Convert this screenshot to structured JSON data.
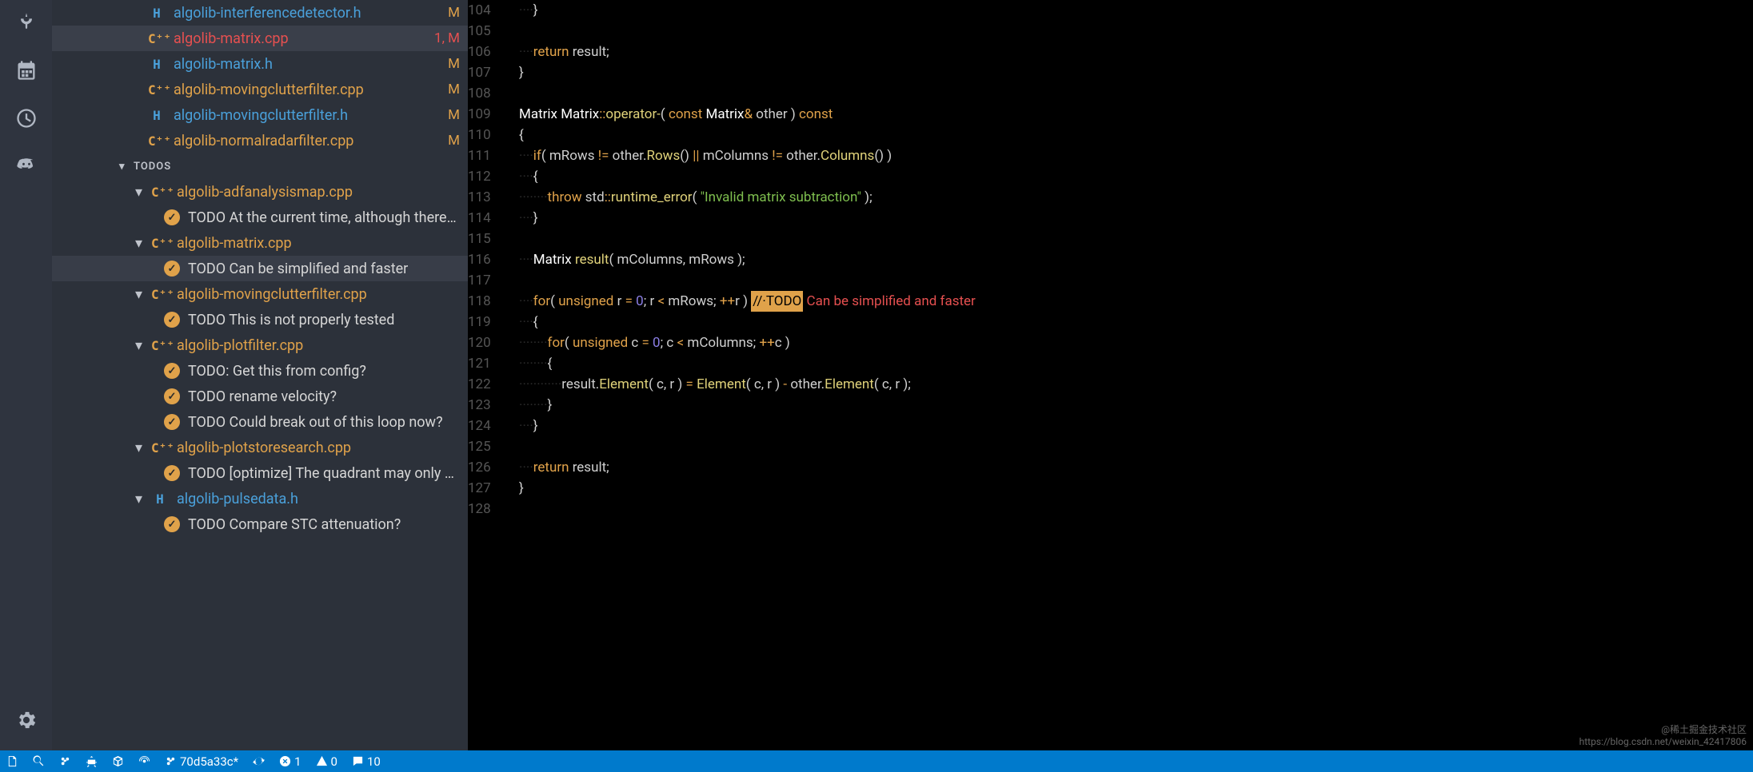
{
  "sidebar": {
    "files": [
      {
        "icon": "H",
        "name": "algolib-interferencedetector.h",
        "badge": "M",
        "sel": false
      },
      {
        "icon": "C++",
        "name": "algolib-matrix.cpp",
        "badge": "1, M",
        "sel": true
      },
      {
        "icon": "H",
        "name": "algolib-matrix.h",
        "badge": "M",
        "sel": false
      },
      {
        "icon": "C++",
        "name": "algolib-movingclutterfilter.cpp",
        "badge": "M",
        "sel": false
      },
      {
        "icon": "H",
        "name": "algolib-movingclutterfilter.h",
        "badge": "M",
        "sel": false
      },
      {
        "icon": "C++",
        "name": "algolib-normalradarfilter.cpp",
        "badge": "M",
        "sel": false
      }
    ],
    "sections": {
      "todos_label": "TODOS"
    },
    "todos": [
      {
        "icon": "C++",
        "file": "algolib-adfanalysismap.cpp",
        "items": [
          {
            "text": "TODO At the current time, although there is s…",
            "hl": false
          }
        ]
      },
      {
        "icon": "C++",
        "file": "algolib-matrix.cpp",
        "items": [
          {
            "text": "TODO Can be simplified and faster",
            "hl": true
          }
        ]
      },
      {
        "icon": "C++",
        "file": "algolib-movingclutterfilter.cpp",
        "items": [
          {
            "text": "TODO This is not properly tested",
            "hl": false
          }
        ]
      },
      {
        "icon": "C++",
        "file": "algolib-plotfilter.cpp",
        "items": [
          {
            "text": "TODO: Get this from config?",
            "hl": false
          },
          {
            "text": "TODO rename velocity?",
            "hl": false
          },
          {
            "text": "TODO Could break out of this loop now?",
            "hl": false
          }
        ]
      },
      {
        "icon": "C++",
        "file": "algolib-plotstoresearch.cpp",
        "items": [
          {
            "text": "TODO [optimize] The quadrant may only need…",
            "hl": false
          }
        ]
      },
      {
        "icon": "H",
        "file": "algolib-pulsedata.h",
        "items": [
          {
            "text": "TODO Compare STC attenuation?",
            "hl": false
          }
        ]
      }
    ]
  },
  "editor": {
    "lines": [
      {
        "n": 104,
        "seg": [
          {
            "c": "ws",
            "t": "····"
          },
          {
            "c": "",
            "t": "}"
          }
        ]
      },
      {
        "n": 105,
        "seg": []
      },
      {
        "n": 106,
        "seg": [
          {
            "c": "ws",
            "t": "····"
          },
          {
            "c": "op",
            "t": "return "
          },
          {
            "c": "",
            "t": "result;"
          }
        ]
      },
      {
        "n": 107,
        "seg": [
          {
            "c": "",
            "t": "}"
          }
        ]
      },
      {
        "n": 108,
        "seg": []
      },
      {
        "n": 109,
        "seg": [
          {
            "c": "ty",
            "t": "Matrix "
          },
          {
            "c": "ty",
            "t": "Matrix"
          },
          {
            "c": "op",
            "t": "::"
          },
          {
            "c": "fn",
            "t": "operator-"
          },
          {
            "c": "",
            "t": "( "
          },
          {
            "c": "op",
            "t": "const "
          },
          {
            "c": "ty",
            "t": "Matrix"
          },
          {
            "c": "op",
            "t": "& "
          },
          {
            "c": "",
            "t": "other ) "
          },
          {
            "c": "op",
            "t": "const"
          }
        ]
      },
      {
        "n": 110,
        "seg": [
          {
            "c": "",
            "t": "{"
          }
        ]
      },
      {
        "n": 111,
        "seg": [
          {
            "c": "ws",
            "t": "····"
          },
          {
            "c": "op",
            "t": "if"
          },
          {
            "c": "",
            "t": "( mRows "
          },
          {
            "c": "op",
            "t": "!= "
          },
          {
            "c": "",
            "t": "other."
          },
          {
            "c": "fn",
            "t": "Rows"
          },
          {
            "c": "",
            "t": "() "
          },
          {
            "c": "op",
            "t": "|| "
          },
          {
            "c": "",
            "t": "mColumns "
          },
          {
            "c": "op",
            "t": "!= "
          },
          {
            "c": "",
            "t": "other."
          },
          {
            "c": "fn",
            "t": "Columns"
          },
          {
            "c": "",
            "t": "() )"
          }
        ]
      },
      {
        "n": 112,
        "seg": [
          {
            "c": "ws",
            "t": "····"
          },
          {
            "c": "",
            "t": "{"
          }
        ]
      },
      {
        "n": 113,
        "seg": [
          {
            "c": "ws",
            "t": "········"
          },
          {
            "c": "op",
            "t": "throw "
          },
          {
            "c": "",
            "t": "std"
          },
          {
            "c": "op",
            "t": "::"
          },
          {
            "c": "fn",
            "t": "runtime_error"
          },
          {
            "c": "",
            "t": "( "
          },
          {
            "c": "st",
            "t": "\"Invalid matrix subtraction\""
          },
          {
            "c": "",
            "t": " );"
          }
        ]
      },
      {
        "n": 114,
        "seg": [
          {
            "c": "ws",
            "t": "····"
          },
          {
            "c": "",
            "t": "}"
          }
        ]
      },
      {
        "n": 115,
        "seg": []
      },
      {
        "n": 116,
        "seg": [
          {
            "c": "ws",
            "t": "····"
          },
          {
            "c": "ty",
            "t": "Matrix "
          },
          {
            "c": "fn",
            "t": "result"
          },
          {
            "c": "",
            "t": "( mColumns, mRows );"
          }
        ]
      },
      {
        "n": 117,
        "seg": []
      },
      {
        "n": 118,
        "seg": [
          {
            "c": "ws",
            "t": "····"
          },
          {
            "c": "op",
            "t": "for"
          },
          {
            "c": "",
            "t": "( "
          },
          {
            "c": "op",
            "t": "unsigned "
          },
          {
            "c": "",
            "t": "r "
          },
          {
            "c": "op",
            "t": "= "
          },
          {
            "c": "nm",
            "t": "0"
          },
          {
            "c": "",
            "t": "; r "
          },
          {
            "c": "op",
            "t": "< "
          },
          {
            "c": "",
            "t": "mRows; "
          },
          {
            "c": "op",
            "t": "++"
          },
          {
            "c": "",
            "t": "r ) "
          },
          {
            "c": "todo-hl",
            "t": "//·TODO"
          },
          {
            "c": "cm",
            "t": " Can be simplified and faster"
          }
        ]
      },
      {
        "n": 119,
        "seg": [
          {
            "c": "ws",
            "t": "····"
          },
          {
            "c": "",
            "t": "{"
          }
        ]
      },
      {
        "n": 120,
        "seg": [
          {
            "c": "ws",
            "t": "········"
          },
          {
            "c": "op",
            "t": "for"
          },
          {
            "c": "",
            "t": "( "
          },
          {
            "c": "op",
            "t": "unsigned "
          },
          {
            "c": "",
            "t": "c "
          },
          {
            "c": "op",
            "t": "= "
          },
          {
            "c": "nm",
            "t": "0"
          },
          {
            "c": "",
            "t": "; c "
          },
          {
            "c": "op",
            "t": "< "
          },
          {
            "c": "",
            "t": "mColumns; "
          },
          {
            "c": "op",
            "t": "++"
          },
          {
            "c": "",
            "t": "c )"
          }
        ]
      },
      {
        "n": 121,
        "seg": [
          {
            "c": "ws",
            "t": "········"
          },
          {
            "c": "",
            "t": "{"
          }
        ]
      },
      {
        "n": 122,
        "seg": [
          {
            "c": "ws",
            "t": "············"
          },
          {
            "c": "",
            "t": "result."
          },
          {
            "c": "fn",
            "t": "Element"
          },
          {
            "c": "",
            "t": "( c, r ) "
          },
          {
            "c": "op",
            "t": "= "
          },
          {
            "c": "fn",
            "t": "Element"
          },
          {
            "c": "",
            "t": "( c, r ) "
          },
          {
            "c": "op",
            "t": "- "
          },
          {
            "c": "",
            "t": "other."
          },
          {
            "c": "fn",
            "t": "Element"
          },
          {
            "c": "",
            "t": "( c, r );"
          }
        ]
      },
      {
        "n": 123,
        "seg": [
          {
            "c": "ws",
            "t": "········"
          },
          {
            "c": "",
            "t": "}"
          }
        ]
      },
      {
        "n": 124,
        "seg": [
          {
            "c": "ws",
            "t": "····"
          },
          {
            "c": "",
            "t": "}"
          }
        ]
      },
      {
        "n": 125,
        "seg": []
      },
      {
        "n": 126,
        "seg": [
          {
            "c": "ws",
            "t": "····"
          },
          {
            "c": "op",
            "t": "return "
          },
          {
            "c": "",
            "t": "result;"
          }
        ]
      },
      {
        "n": 127,
        "seg": [
          {
            "c": "",
            "t": "}"
          }
        ]
      },
      {
        "n": 128,
        "seg": []
      }
    ]
  },
  "status": {
    "branch": "70d5a33c*",
    "errors": "1",
    "warnings": "0",
    "comments": "10"
  },
  "watermark": {
    "a": "@稀土掘金技术社区",
    "b": "https://blog.csdn.net/weixin_42417806"
  }
}
